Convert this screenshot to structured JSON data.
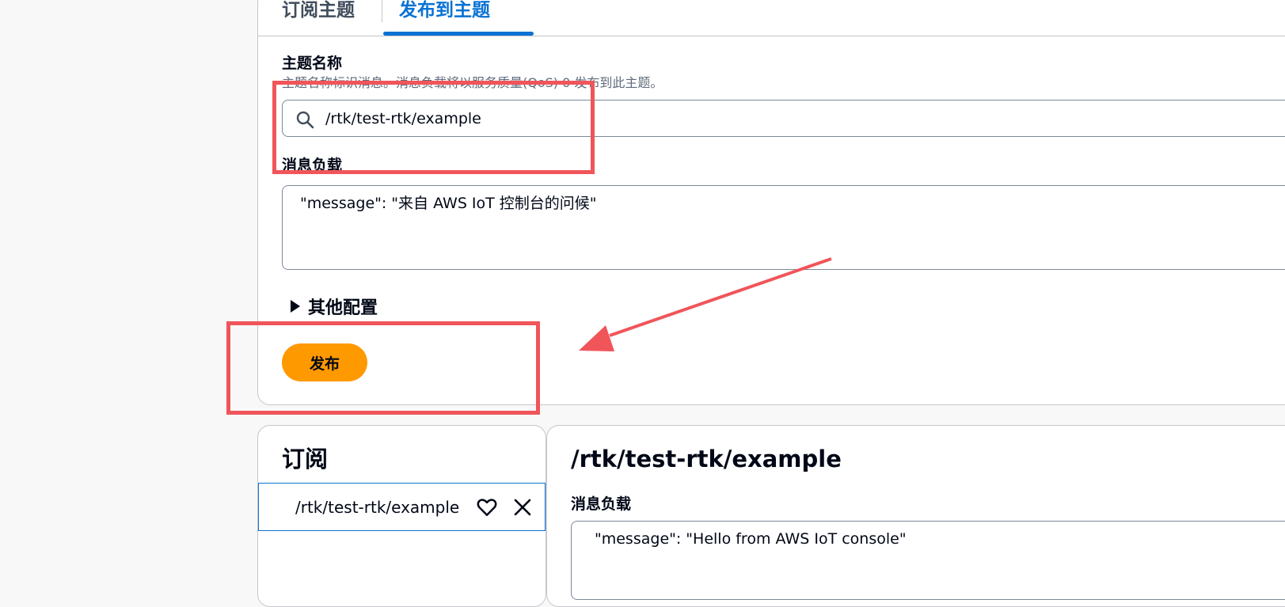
{
  "tabs": [
    {
      "label": "订阅主题"
    },
    {
      "label": "发布到主题"
    }
  ],
  "publish": {
    "topic_label": "主题名称",
    "topic_description": "主题名称标识消息。消息负载将以服务质量(QoS) 0 发布到此主题。",
    "topic_value": "/rtk/test-rtk/example",
    "payload_label": "消息负载",
    "payload_value": "\"message\": \"来自 AWS IoT 控制台的问候\"",
    "additional_config_label": "其他配置",
    "publish_button_label": "发布"
  },
  "subscriptions": {
    "title": "订阅",
    "items": [
      {
        "topic": "/rtk/test-rtk/example"
      }
    ]
  },
  "message_detail": {
    "topic": "/rtk/test-rtk/example",
    "payload_label": "消息负载",
    "payload_value": "\"message\": \"Hello from AWS IoT console\""
  },
  "colors": {
    "accent": "#0972d3",
    "primary_button": "#ff9900",
    "annotation": "#f0555a"
  },
  "icons": [
    "search-icon",
    "heart-icon",
    "close-icon",
    "caret-right-icon"
  ]
}
